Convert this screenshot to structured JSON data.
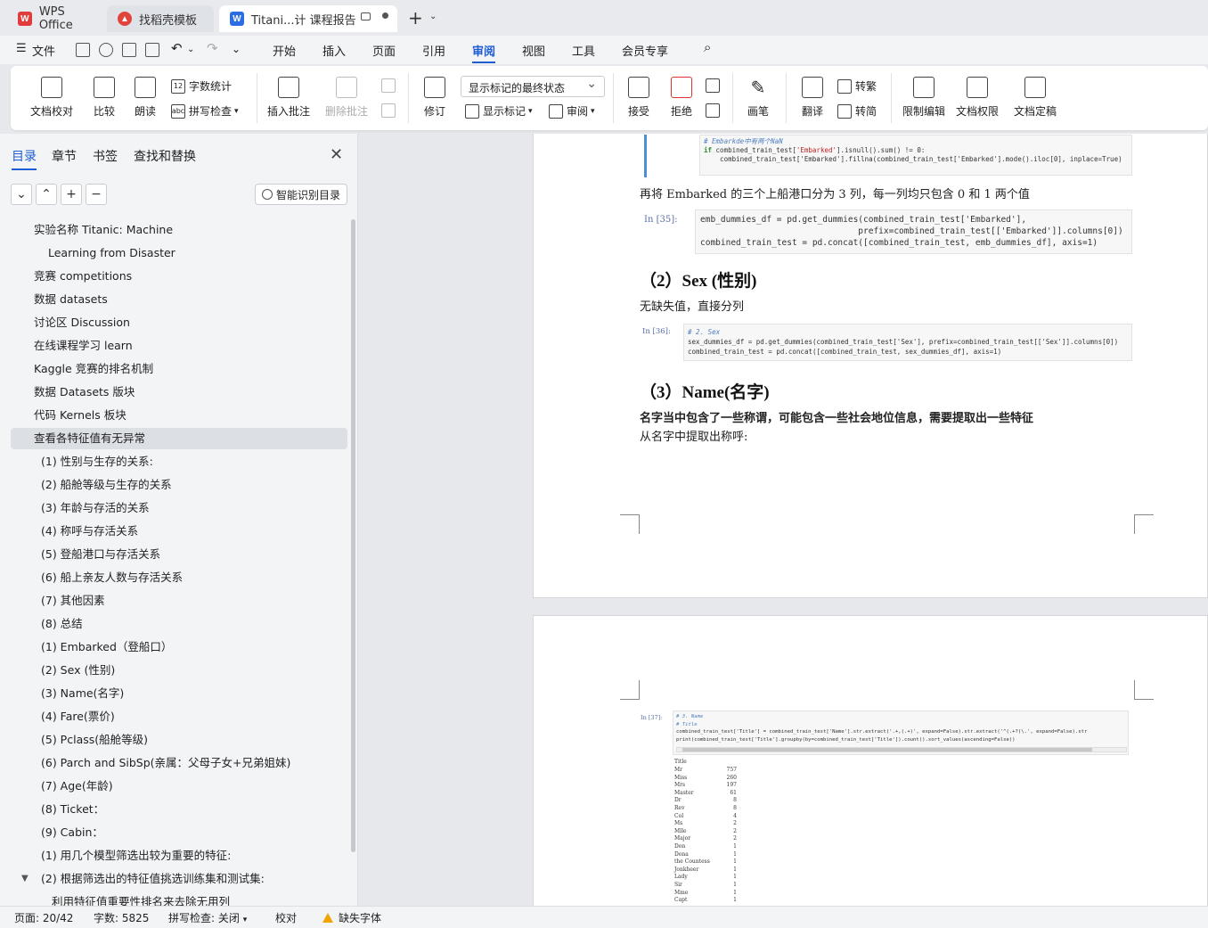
{
  "tabs": {
    "wps": "WPS Office",
    "daoke": "找稻壳模板",
    "doc": "Titani...计 课程报告"
  },
  "colors": {
    "accent": "#1e5cd6",
    "wps_red": "#e23b3b",
    "doc_blue": "#2b6de5"
  },
  "menu": {
    "file": "文件",
    "tabs": [
      "开始",
      "插入",
      "页面",
      "引用",
      "审阅",
      "视图",
      "工具",
      "会员专享"
    ],
    "active": "审阅"
  },
  "ribbon": {
    "doc_check": "文档校对",
    "compare": "比较",
    "read_aloud": "朗读",
    "word_count": "字数统计",
    "spell_check": "拼写检查",
    "insert_comment": "插入批注",
    "delete_comment": "删除批注",
    "revise": "修订",
    "markup_select": "显示标记的最终状态",
    "show_markup": "显示标记",
    "review": "审阅",
    "accept": "接受",
    "reject": "拒绝",
    "pen": "画笔",
    "translate": "翻译",
    "to_traditional": "转繁",
    "to_simplified": "转简",
    "restrict_edit": "限制编辑",
    "doc_permission": "文档权限",
    "doc_finalize": "文档定稿"
  },
  "nav": {
    "tabs": [
      "目录",
      "章节",
      "书签",
      "查找和替换"
    ],
    "smart_toc": "智能识别目录",
    "items": [
      "实验名称    Titanic: Machine",
      "Learning  from Disaster",
      "竞赛 competitions",
      "数据 datasets",
      "讨论区  Discussion",
      "在线课程学习 learn",
      "Kaggle 竞赛的排名机制",
      "数据 Datasets 版块",
      "代码 Kernels 板块",
      "查看各特征值有无异常",
      "(1)  性别与生存的关系:",
      "(2)  船舱等级与生存的关系",
      "(3)  年龄与存活的关系",
      "(4)  称呼与存活关系",
      "(5)  登船港口与存活关系",
      "(6)  船上亲友人数与存活关系",
      "(7)  其他因素",
      "(8)  总结",
      "(1)  Embarked（登船口）",
      "(2)  Sex (性别)",
      "(3)  Name(名字)",
      "(4)  Fare(票价)",
      "(5)  Pclass(船舱等级)",
      "(6)  Parch and SibSp(亲属：父母子女+兄弟姐妹)",
      "(7)  Age(年龄)",
      "(8)  Ticket：",
      "(9)  Cabin：",
      "(1)  用几个模型筛选出较为重要的特征:",
      "(2)  根据筛选出的特征值挑选训练集和测试集:",
      "利用特征值重要性排名来去除无用列"
    ]
  },
  "doc": {
    "cell34_comment": "# Embarkde中有两个NaN",
    "cell34_line1_a": "if",
    "cell34_line1_b": " combined_train_test[",
    "cell34_line1_c": "'Embarked'",
    "cell34_line1_d": "].isnull().sum() != 0:",
    "cell34_line2": "    combined_train_test['Embarked'].fillna(combined_train_test['Embarked'].mode().iloc[0], inplace=True)",
    "para_embarked": "再将 Embarked 的三个上船港口分为 3 列，每一列均只包含 0 和 1 两个值",
    "in35": "In  [35]:",
    "cell35_l1": "emb_dummies_df = pd.get_dummies(combined_train_test['Embarked'],",
    "cell35_l2": "                               prefix=combined_train_test[['Embarked']].columns[0])",
    "cell35_l3": "combined_train_test = pd.concat([combined_train_test, emb_dummies_df], axis=1)",
    "h_sex": "（2）Sex (性别)",
    "para_sex": "无缺失值，直接分列",
    "in36": "In  [36]:",
    "cell36_l1": "# 2. Sex",
    "cell36_l2": "sex_dummies_df = pd.get_dummies(combined_train_test['Sex'], prefix=combined_train_test[['Sex']].columns[0])",
    "cell36_l3": "combined_train_test = pd.concat([combined_train_test, sex_dummies_df], axis=1)",
    "h_name": "（3）Name(名字)",
    "para_name1": "名字当中包含了一些称谓，可能包含一些社会地位信息，需要提取出一些特征",
    "para_name2": "从名字中提取出称呼:",
    "in37": "In  [37]:",
    "cell37_l1": "# 3. Name",
    "cell37_l2": "# Title",
    "cell37_l3": "combined_train_test['Title'] = combined_train_test['Name'].str.extract('.+,(.+)', expand=False).str.extract('^(.+?)\\.', expand=False).str",
    "cell37_l4": "print(combined_train_test['Title'].groupby(by=combined_train_test['Title']).count().sort_values(ascending=False))",
    "output_header": "Title",
    "output_rows": [
      [
        "Mr",
        "757"
      ],
      [
        "Miss",
        "260"
      ],
      [
        "Mrs",
        "197"
      ],
      [
        "Master",
        "61"
      ],
      [
        "Dr",
        "8"
      ],
      [
        "Rev",
        "8"
      ],
      [
        "Col",
        "4"
      ],
      [
        "Ms",
        "2"
      ],
      [
        "Mlle",
        "2"
      ],
      [
        "Major",
        "2"
      ],
      [
        "Don",
        "1"
      ],
      [
        "Dona",
        "1"
      ],
      [
        "the Countess",
        "1"
      ],
      [
        "Jonkheer",
        "1"
      ],
      [
        "Lady",
        "1"
      ],
      [
        "Sir",
        "1"
      ],
      [
        "Mme",
        "1"
      ],
      [
        "Capt",
        "1"
      ]
    ]
  },
  "status": {
    "page": "页面: 20/42",
    "words": "字数: 5825",
    "spell": "拼写检查: 关闭",
    "proof": "校对",
    "missing_font": "缺失字体"
  }
}
